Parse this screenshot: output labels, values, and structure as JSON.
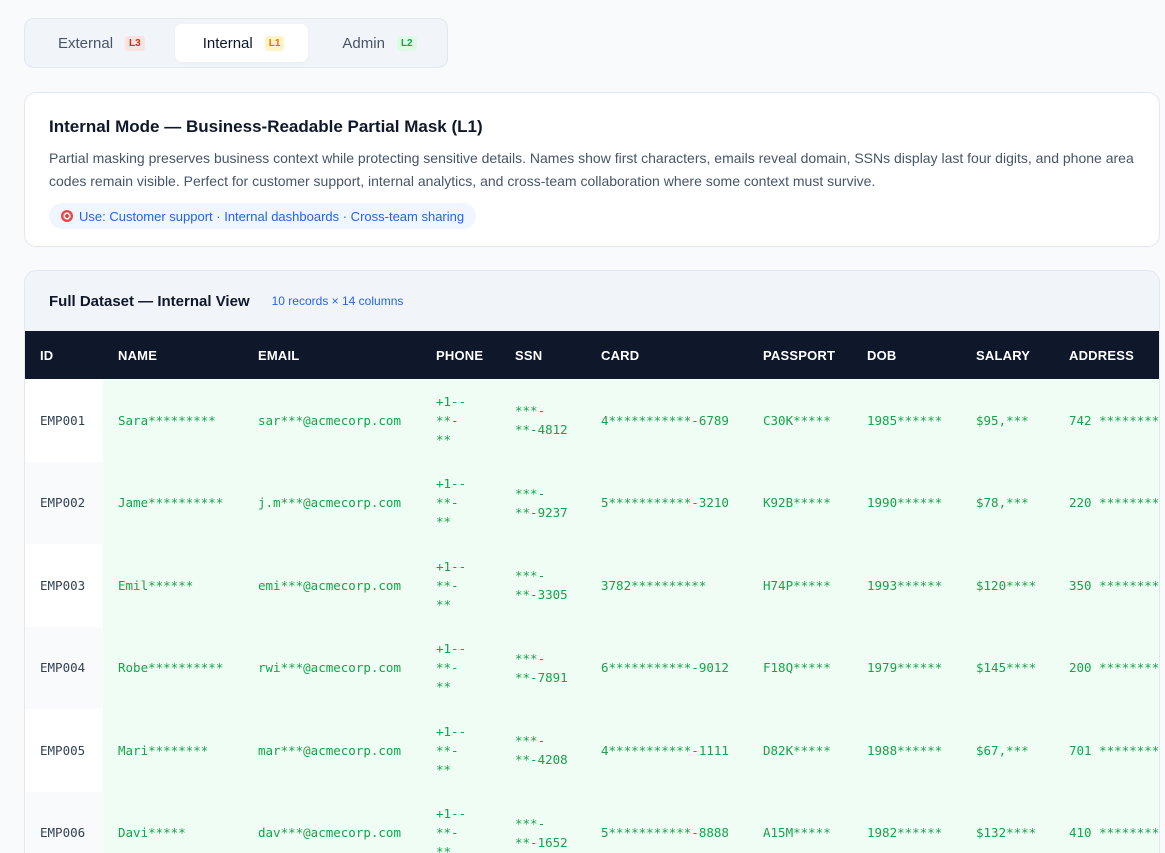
{
  "tabs": [
    {
      "label": "External",
      "level": "L3"
    },
    {
      "label": "Internal",
      "level": "L1"
    },
    {
      "label": "Admin",
      "level": "L2"
    }
  ],
  "info": {
    "title": "Internal Mode — Business-Readable Partial Mask (L1)",
    "description": "Partial masking preserves business context while protecting sensitive details. Names show first characters, emails reveal domain, SSNs display last four digits, and phone area codes remain visible. Perfect for customer support, internal analytics, and cross-team collaboration where some context must survive.",
    "use": "Use: Customer support · Internal dashboards · Cross-team sharing"
  },
  "dataset": {
    "title": "Full Dataset — Internal View",
    "meta": "10 records × 14 columns",
    "columns": [
      "ID",
      "NAME",
      "EMAIL",
      "PHONE",
      "SSN",
      "CARD",
      "PASSPORT",
      "DOB",
      "SALARY",
      "ADDRESS"
    ],
    "rows": [
      {
        "id": "EMP001",
        "name": "Sara*********",
        "email": "sar***@acmecorp.com",
        "phone": [
          "+1--",
          "**-",
          "**"
        ],
        "ssn": [
          "***-",
          "**-4812"
        ],
        "card": "4***********-6789",
        "passport": "C30K*****",
        "dob": "1985******",
        "salary": "$95,***",
        "address": "742 ********"
      },
      {
        "id": "EMP002",
        "name": "Jame**********",
        "email": "j.m***@acmecorp.com",
        "phone": [
          "+1--",
          "**-",
          "**"
        ],
        "ssn": [
          "***-",
          "**-9237"
        ],
        "card": "5***********-3210",
        "passport": "K92B*****",
        "dob": "1990******",
        "salary": "$78,***",
        "address": "220 ********"
      },
      {
        "id": "EMP003",
        "name": "Emil******",
        "email": "emi***@acmecorp.com",
        "phone": [
          "+1--",
          "**-",
          "**"
        ],
        "ssn": [
          "***-",
          "**-3305"
        ],
        "card": "3782**********",
        "passport": "H74P*****",
        "dob": "1993******",
        "salary": "$120****",
        "address": "350 ********"
      },
      {
        "id": "EMP004",
        "name": "Robe**********",
        "email": "rwi***@acmecorp.com",
        "phone": [
          "+1--",
          "**-",
          "**"
        ],
        "ssn": [
          "***-",
          "**-7891"
        ],
        "card": "6***********-9012",
        "passport": "F18Q*****",
        "dob": "1979******",
        "salary": "$145****",
        "address": "200 ********"
      },
      {
        "id": "EMP005",
        "name": "Mari********",
        "email": "mar***@acmecorp.com",
        "phone": [
          "+1--",
          "**-",
          "**"
        ],
        "ssn": [
          "***-",
          "**-4208"
        ],
        "card": "4***********-1111",
        "passport": "D82K*****",
        "dob": "1988******",
        "salary": "$67,***",
        "address": "701 ********"
      },
      {
        "id": "EMP006",
        "name": "Davi*****",
        "email": "dav***@acmecorp.com",
        "phone": [
          "+1--",
          "**-",
          "**"
        ],
        "ssn": [
          "***-",
          "**-1652"
        ],
        "card": "5***********-8888",
        "passport": "A15M*****",
        "dob": "1982******",
        "salary": "$132****",
        "address": "410 ********"
      }
    ]
  }
}
